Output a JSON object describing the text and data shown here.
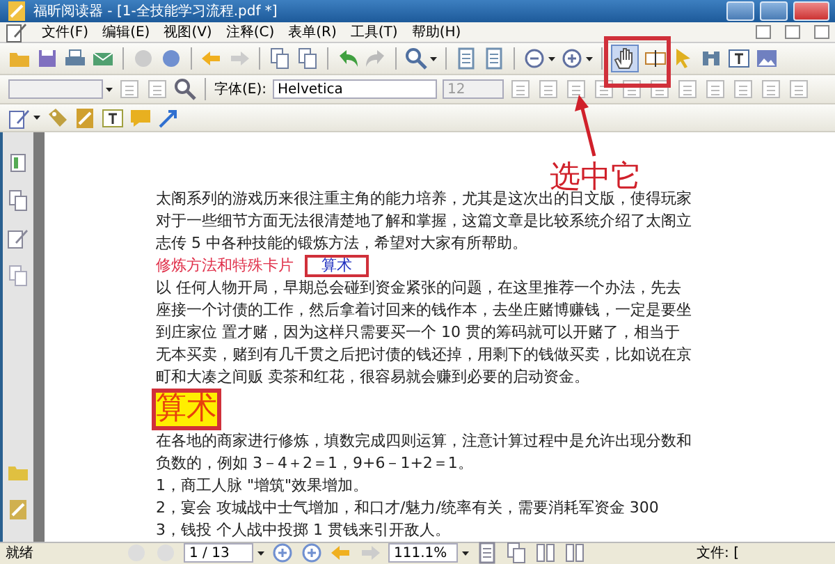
{
  "window": {
    "title": "福昕阅读器 - [1-全技能学习流程.pdf *]"
  },
  "menu": [
    {
      "label": "文件(F)"
    },
    {
      "label": "编辑(E)"
    },
    {
      "label": "视图(V)"
    },
    {
      "label": "注释(C)"
    },
    {
      "label": "表单(R)"
    },
    {
      "label": "工具(T)"
    },
    {
      "label": "帮助(H)"
    }
  ],
  "toolbar": {
    "hand_tool_selected": true
  },
  "format_bar": {
    "font_label": "字体(E):",
    "font": "Helvetica",
    "size": "12"
  },
  "document": {
    "lines": [
      {
        "kind": "body",
        "text": "太阁系列的游戏历来很注重主角的能力培养，尤其是这次出的日文版，使得玩家"
      },
      {
        "kind": "body",
        "text": "对于一些细节方面无法很清楚地了解和掌握，这篇文章是比较系统介绍了太阁立"
      },
      {
        "kind": "body",
        "text": "志传 5 中各种技能的锻炼方法，希望对大家有所帮助。"
      },
      {
        "kind": "section",
        "text": "修炼方法和特殊卡片"
      },
      {
        "kind": "body",
        "text": "以 任何人物开局，早期总会碰到资金紧张的问题，在这里推荐一个办法，先去"
      },
      {
        "kind": "body",
        "text": "座接一个讨债的工作，然后拿着讨回来的钱作本，去坐庄赌博赚钱，一定是要坐"
      },
      {
        "kind": "body",
        "text": "到庄家位 置才赌，因为这样只需要买一个 10 贯的筹码就可以开赌了，相当于"
      },
      {
        "kind": "body",
        "text": "无本买卖，赌到有几千贯之后把讨债的钱还掉，用剩下的钱做买卖，比如说在京"
      },
      {
        "kind": "body",
        "text": "町和大凑之间贩 卖茶和红花，很容易就会赚到必要的启动资金。"
      },
      {
        "kind": "heading",
        "text": "算术"
      },
      {
        "kind": "body",
        "text": "在各地的商家进行修炼，填数完成四则运算，注意计算过程中是允许出现分数和"
      },
      {
        "kind": "body",
        "text": "负数的，例如 3－4＋2＝1，9+6－1+2＝1。"
      },
      {
        "kind": "body",
        "text": "1，商工人脉 \"增筑\"效果增加。"
      },
      {
        "kind": "body",
        "text": "2，宴会 攻城战中士气增加，和口才/魅力/统率有关，需要消耗军资金 300"
      },
      {
        "kind": "body",
        "text": "3，钱投 个人战中投掷 1 贯钱来引开敌人。"
      }
    ]
  },
  "popup": {
    "text": "算术"
  },
  "annotation": {
    "text": "选中它"
  },
  "status_bar": {
    "status": "就绪",
    "page": "1 / 13",
    "zoom": "111.1%",
    "file_label": "文件: ["
  }
}
